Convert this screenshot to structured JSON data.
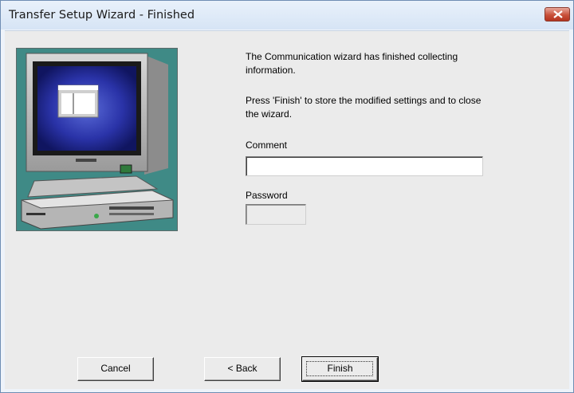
{
  "window": {
    "title": "Transfer Setup Wizard - Finished"
  },
  "main": {
    "message_line1": "The Communication wizard has finished collecting",
    "message_line2": "information.",
    "instruction_line1": "Press 'Finish' to store the modified settings and to close",
    "instruction_line2": "the wizard.",
    "comment_label": "Comment",
    "comment_value": "",
    "password_label": "Password",
    "password_value": ""
  },
  "buttons": {
    "cancel": "Cancel",
    "back": "< Back",
    "finish": "Finish"
  },
  "icons": {
    "close": "close-icon",
    "illustration": "computer-illustration"
  }
}
